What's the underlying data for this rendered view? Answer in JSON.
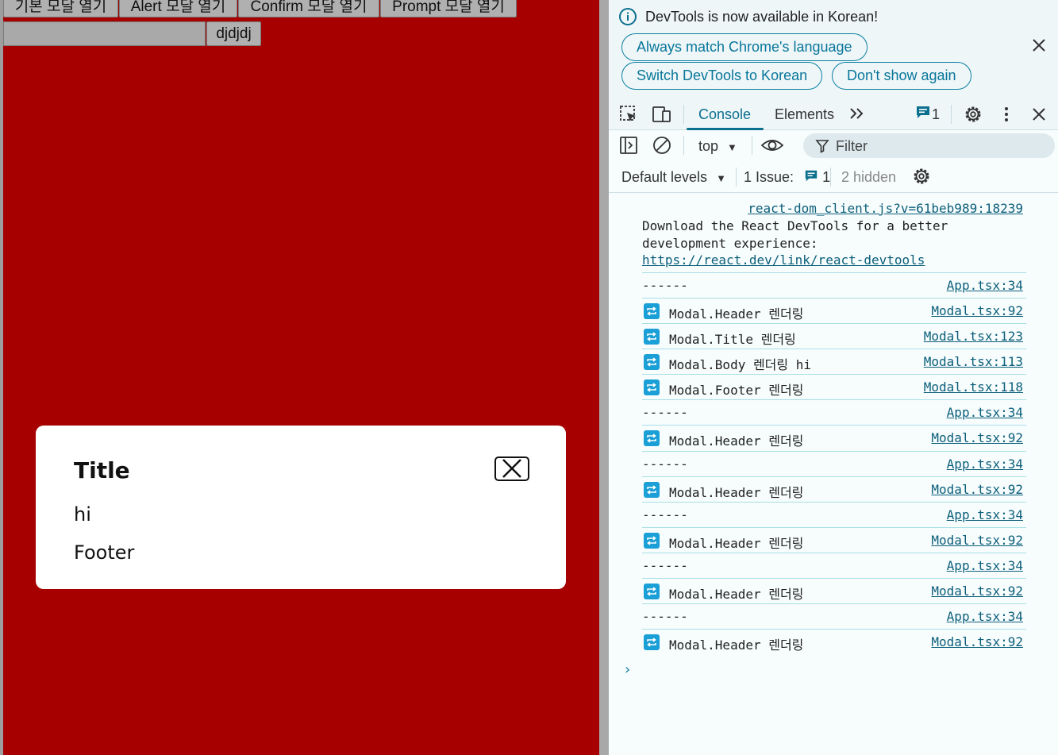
{
  "app": {
    "buttons": [
      "기본 모달 열기",
      "Alert 모달 열기",
      "Confirm 모달 열기",
      "Prompt 모달 열기"
    ],
    "input_value": "",
    "submit_label": "djdjdj",
    "colors": {
      "background": "#a60000"
    },
    "modal": {
      "title": "Title",
      "body": "hi",
      "footer": "Footer",
      "close_icon": "close-icon"
    }
  },
  "devtools": {
    "infobar": {
      "message": "DevTools is now available in Korean!",
      "buttons": [
        "Always match Chrome's language",
        "Switch DevTools to Korean",
        "Don't show again"
      ]
    },
    "tabs": {
      "console": "Console",
      "elements": "Elements",
      "message_count": "1"
    },
    "toolbar": {
      "context": "top",
      "filter_placeholder": "Filter",
      "levels": "Default levels",
      "issues_label": "1 Issue:",
      "issues_count": "1",
      "hidden": "2 hidden"
    },
    "console": {
      "first": {
        "source": "react-dom_client.js?v=61beb989:18239",
        "line1": "Download the React DevTools for a better",
        "line2": "development experience:",
        "link": "https://react.dev/link/react-devtools"
      },
      "rows": [
        {
          "text": "------",
          "source": "App.tsx:34",
          "icon": false
        },
        {
          "text": "Modal.Header 렌더링",
          "source": "Modal.tsx:92",
          "icon": true
        },
        {
          "text": "Modal.Title 렌더링",
          "source": "Modal.tsx:123",
          "icon": true
        },
        {
          "text": "Modal.Body 렌더링 hi",
          "source": "Modal.tsx:113",
          "icon": true
        },
        {
          "text": "Modal.Footer 렌더링",
          "source": "Modal.tsx:118",
          "icon": true
        },
        {
          "text": "------",
          "source": "App.tsx:34",
          "icon": false
        },
        {
          "text": "Modal.Header 렌더링",
          "source": "Modal.tsx:92",
          "icon": true
        },
        {
          "text": "------",
          "source": "App.tsx:34",
          "icon": false
        },
        {
          "text": "Modal.Header 렌더링",
          "source": "Modal.tsx:92",
          "icon": true
        },
        {
          "text": "------",
          "source": "App.tsx:34",
          "icon": false
        },
        {
          "text": "Modal.Header 렌더링",
          "source": "Modal.tsx:92",
          "icon": true
        },
        {
          "text": "------",
          "source": "App.tsx:34",
          "icon": false
        },
        {
          "text": "Modal.Header 렌더링",
          "source": "Modal.tsx:92",
          "icon": true
        },
        {
          "text": "------",
          "source": "App.tsx:34",
          "icon": false
        },
        {
          "text": "Modal.Header 렌더링",
          "source": "Modal.tsx:92",
          "icon": true
        }
      ]
    }
  }
}
